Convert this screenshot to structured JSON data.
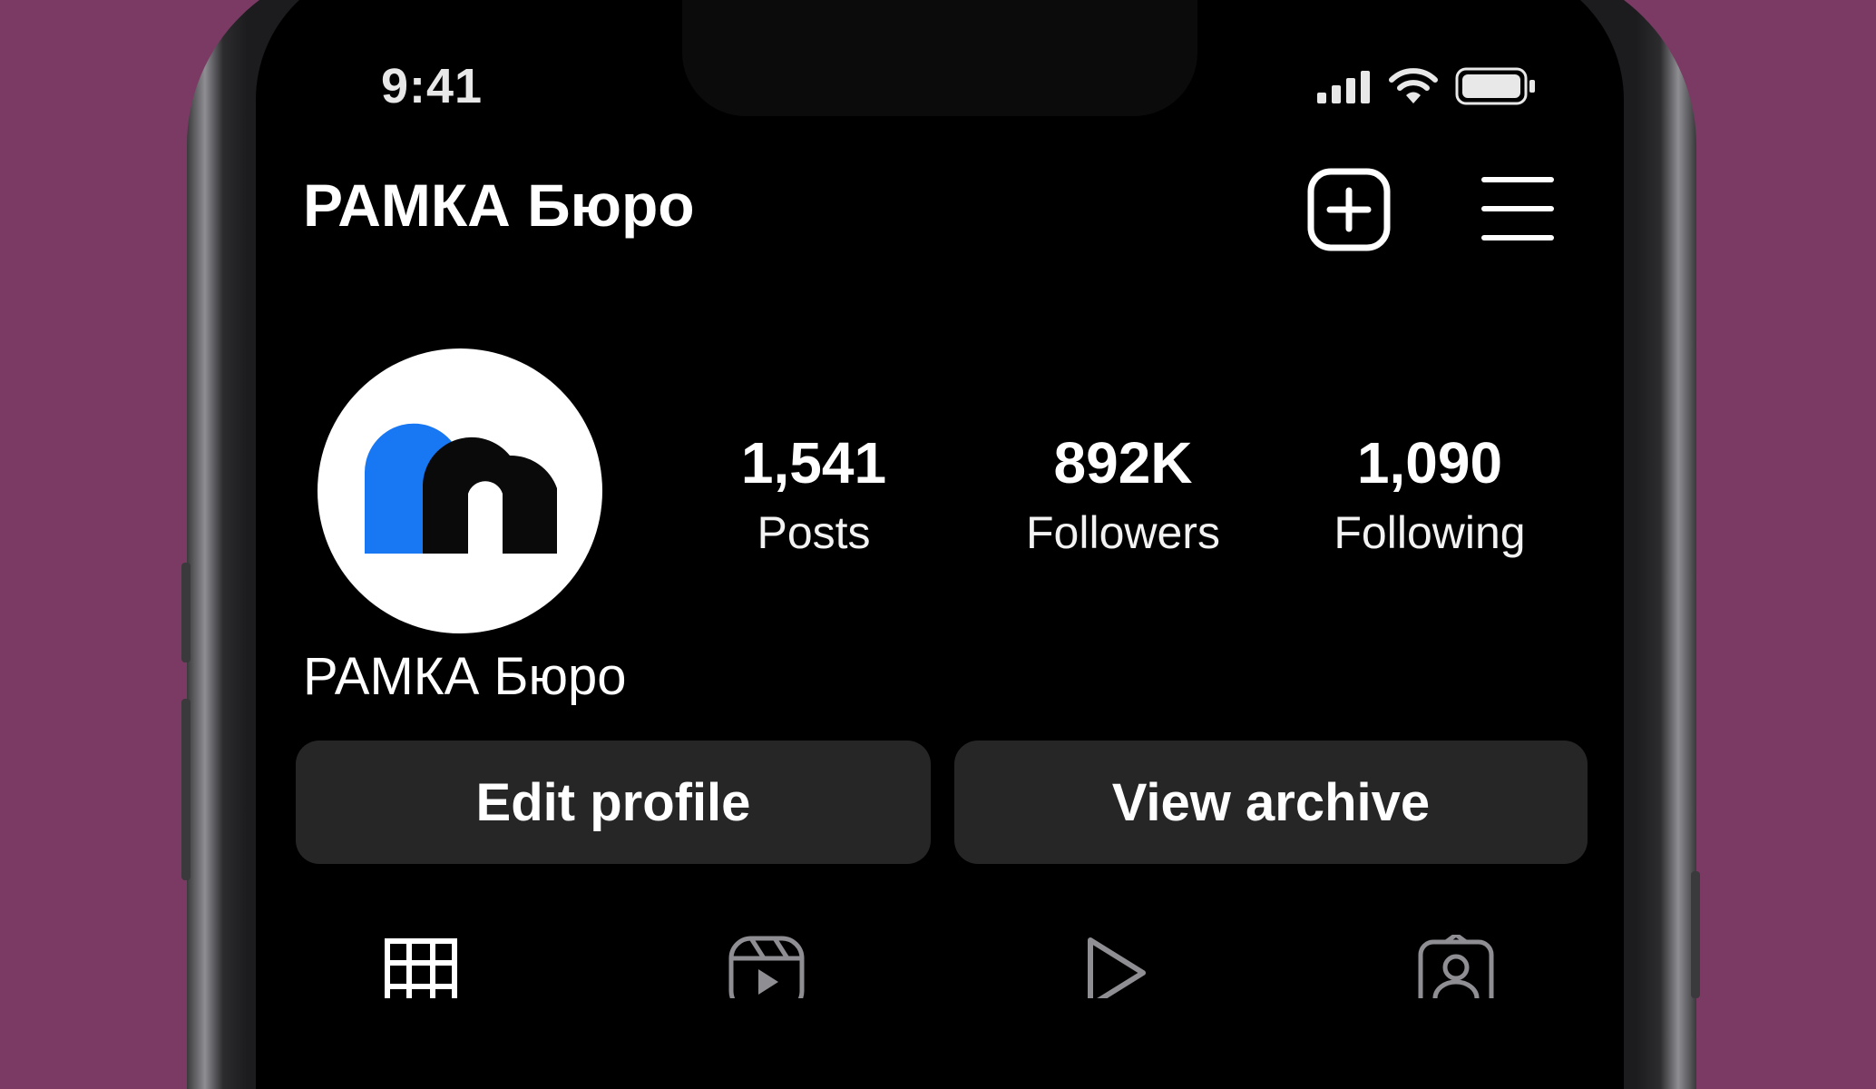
{
  "status_bar": {
    "time": "9:41"
  },
  "header": {
    "title": "РАМКА Бюро",
    "create_icon": "plus-square-icon",
    "menu_icon": "hamburger-menu-icon"
  },
  "profile": {
    "avatar_icon": "rm-logo",
    "display_name": "РАМКА Бюро",
    "stats": [
      {
        "count": "1,541",
        "label": "Posts"
      },
      {
        "count": "892K",
        "label": "Followers"
      },
      {
        "count": "1,090",
        "label": "Following"
      }
    ]
  },
  "actions": {
    "edit_label": "Edit profile",
    "archive_label": "View archive"
  },
  "tabs": [
    {
      "icon": "grid-icon"
    },
    {
      "icon": "reels-icon"
    },
    {
      "icon": "play-icon"
    },
    {
      "icon": "tagged-icon"
    }
  ],
  "colors": {
    "background": "#7a3a64",
    "screen": "#000000",
    "button": "#262626",
    "logo_blue": "#1877f2",
    "logo_black": "#0a0a0a"
  }
}
